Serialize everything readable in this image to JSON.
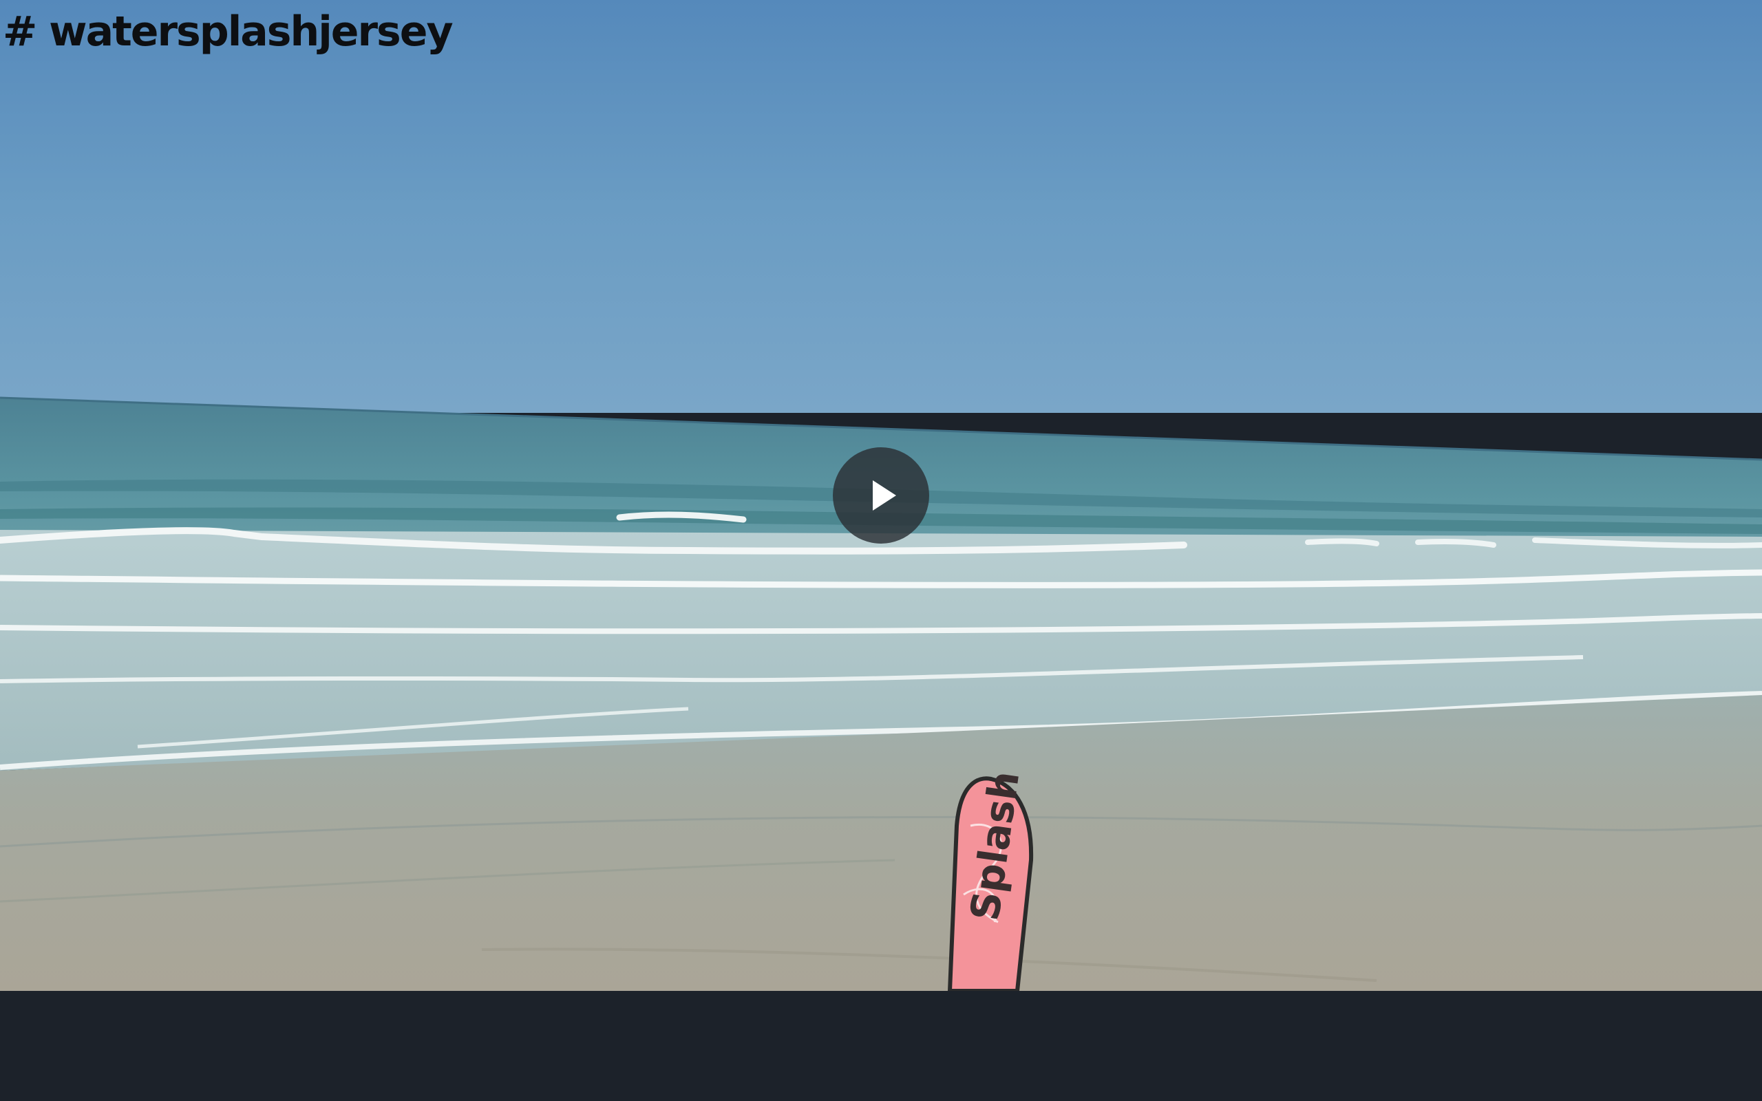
{
  "video": {
    "hashtag": "# watersplashjersey",
    "flag_text": "Splash",
    "play_icon": "play-icon",
    "colors": {
      "sky_top": "#5589bb",
      "sky_horizon": "#7aa6c8",
      "sea": "#4f8a9a",
      "foam": "#e8f0f0",
      "sand": "#a7a49a",
      "flag": "#f4939a",
      "control_bar": "#1c222a"
    }
  }
}
